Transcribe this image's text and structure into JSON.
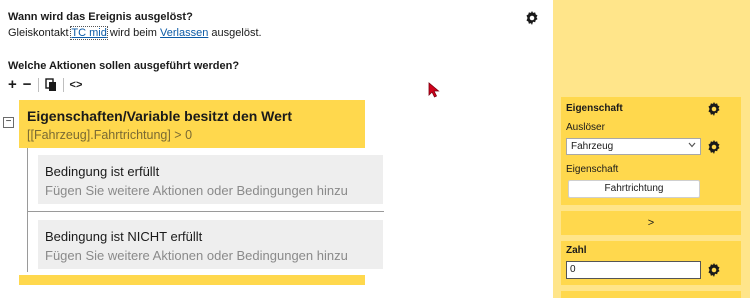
{
  "trigger": {
    "heading": "Wann wird das Ereignis ausgelöst?",
    "sentence_prefix": "Gleiskontakt",
    "contact_link": "TC mid",
    "sentence_middle": "wird beim",
    "event_link": "Verlassen",
    "sentence_suffix": "ausgelöst."
  },
  "actions": {
    "heading": "Welche Aktionen sollen ausgeführt werden?",
    "toolbar": {
      "add": "+",
      "remove": "−",
      "copy_icon": "copy-icon",
      "code": "<>"
    }
  },
  "condition": {
    "collapse_symbol": "−",
    "title": "Eigenschaften/Variable besitzt den Wert",
    "expression": "[[Fahrzeug].Fahrtrichtung] > 0",
    "true_branch": {
      "title": "Bedingung ist erfüllt",
      "hint": "Fügen Sie weitere Aktionen oder Bedingungen hinzu"
    },
    "false_branch": {
      "title": "Bedingung ist NICHT erfüllt",
      "hint": "Fügen Sie weitere Aktionen oder Bedingungen hinzu"
    }
  },
  "panel": {
    "property_section": {
      "title": "Eigenschaft",
      "trigger_label": "Auslöser",
      "trigger_value": "Fahrzeug",
      "property_label": "Eigenschaft",
      "property_button": "Fahrtrichtung"
    },
    "operator": ">",
    "number_section": {
      "title": "Zahl",
      "value": "0"
    }
  },
  "colors": {
    "accent_yellow": "#ffd84d",
    "panel_yellow": "#ffe58a",
    "link": "#0b5aa6",
    "cursor_red": "#d0021b"
  }
}
